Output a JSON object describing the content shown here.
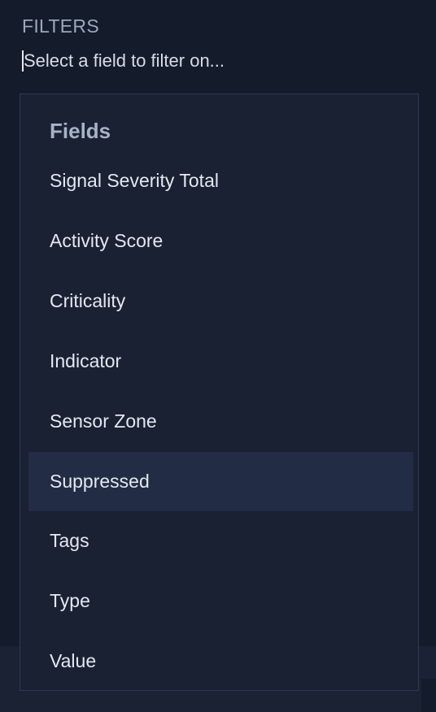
{
  "filters": {
    "label": "FILTERS",
    "search_placeholder": "Select a field to filter on..."
  },
  "dropdown": {
    "group_label": "Fields",
    "options": [
      {
        "label": "Signal Severity Total",
        "highlighted": false
      },
      {
        "label": "Activity Score",
        "highlighted": false
      },
      {
        "label": "Criticality",
        "highlighted": false
      },
      {
        "label": "Indicator",
        "highlighted": false
      },
      {
        "label": "Sensor Zone",
        "highlighted": false
      },
      {
        "label": "Suppressed",
        "highlighted": true
      },
      {
        "label": "Tags",
        "highlighted": false
      },
      {
        "label": "Type",
        "highlighted": false
      },
      {
        "label": "Value",
        "highlighted": false
      }
    ]
  }
}
